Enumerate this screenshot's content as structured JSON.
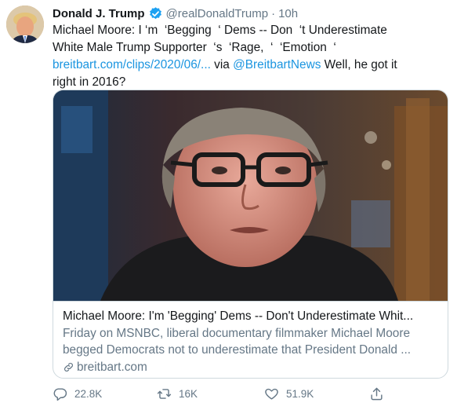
{
  "tweet": {
    "author": {
      "display_name": "Donald J. Trump",
      "handle": "@realDonaldTrump",
      "separator": "·",
      "time": "10h",
      "verified": true
    },
    "text": {
      "line1": "Michael Moore: I ‘m  ‘Begging  ‘ Dems -- Don  ‘t Underestimate",
      "line2": "White Male Trump Supporter  ‘s  ‘Rage,  ‘  ‘Emotion  ‘",
      "link_url": "breitbart.com/clips/2020/06/...",
      "via": " via ",
      "mention": "@BreitbartNews",
      "tail": " Well, he got it",
      "line4": "right in 2016?"
    },
    "card": {
      "title": "Michael Moore: I'm 'Begging' Dems -- Don't Underestimate Whit...",
      "description_line1": "Friday on MSNBC, liberal documentary filmmaker Michael Moore",
      "description_line2": "begged Democrats not to underestimate that President Donald ...",
      "domain": "breitbart.com"
    },
    "actions": {
      "replies": "22.8K",
      "retweets": "16K",
      "likes": "51.9K"
    }
  },
  "colors": {
    "link": "#1b95e0",
    "muted": "#657786",
    "text": "#14171a",
    "border": "#cfd9de"
  },
  "icons": [
    "verified-badge-icon",
    "reply-icon",
    "retweet-icon",
    "like-icon",
    "share-icon",
    "link-icon"
  ]
}
